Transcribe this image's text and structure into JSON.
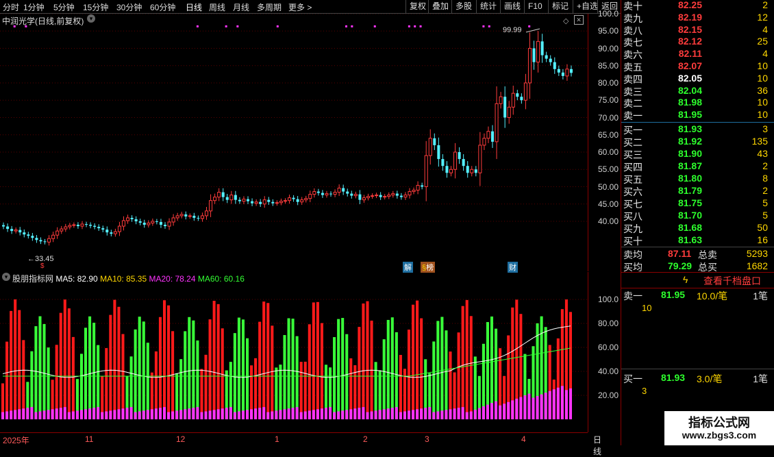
{
  "toolbar": {
    "periods": [
      "分时",
      "1分钟",
      "5分钟",
      "15分钟",
      "30分钟",
      "60分钟",
      "日线",
      "周线",
      "月线",
      "多周期",
      "更多 >"
    ],
    "right": [
      "复权",
      "叠加",
      "多股",
      "统计",
      "画线",
      "F10",
      "标记",
      "+自选",
      "返回"
    ]
  },
  "main_title": "中润光学(日线,前复权)",
  "y_labels_main": [
    "100.0",
    "95.00",
    "90.00",
    "85.00",
    "80.00",
    "75.00",
    "70.00",
    "65.00",
    "60.00",
    "55.00",
    "50.00",
    "45.00",
    "40.00"
  ],
  "annotations": {
    "high": "99.99",
    "low": "33.45",
    "chip_jie": "解",
    "chip_bang": "榜",
    "chip_cai": "财"
  },
  "ind_title": {
    "name": "股朋指标网",
    "ma5": "MA5: 82.90",
    "ma10": "MA10: 85.35",
    "ma20": "MA20: 78.24",
    "ma60": "MA60: 60.16"
  },
  "y_labels_ind": [
    "100.0",
    "80.00",
    "60.00",
    "40.00",
    "20.00"
  ],
  "dates": [
    "2025年",
    "11",
    "12",
    "1",
    "2",
    "3",
    "4"
  ],
  "period_label": "日线",
  "orderbook": {
    "sell": [
      {
        "n": "卖十",
        "p": "82.25",
        "v": "2"
      },
      {
        "n": "卖九",
        "p": "82.19",
        "v": "12"
      },
      {
        "n": "卖八",
        "p": "82.15",
        "v": "4"
      },
      {
        "n": "卖七",
        "p": "82.12",
        "v": "25"
      },
      {
        "n": "卖六",
        "p": "82.11",
        "v": "4"
      },
      {
        "n": "卖五",
        "p": "82.07",
        "v": "10"
      },
      {
        "n": "卖四",
        "p": "82.05",
        "v": "10"
      },
      {
        "n": "卖三",
        "p": "82.04",
        "v": "36"
      },
      {
        "n": "卖二",
        "p": "81.98",
        "v": "10"
      },
      {
        "n": "卖一",
        "p": "81.95",
        "v": "10"
      }
    ],
    "buy": [
      {
        "n": "买一",
        "p": "81.93",
        "v": "3"
      },
      {
        "n": "买二",
        "p": "81.92",
        "v": "135"
      },
      {
        "n": "买三",
        "p": "81.90",
        "v": "43"
      },
      {
        "n": "买四",
        "p": "81.87",
        "v": "2"
      },
      {
        "n": "买五",
        "p": "81.80",
        "v": "8"
      },
      {
        "n": "买六",
        "p": "81.79",
        "v": "2"
      },
      {
        "n": "买七",
        "p": "81.75",
        "v": "5"
      },
      {
        "n": "买八",
        "p": "81.70",
        "v": "5"
      },
      {
        "n": "买九",
        "p": "81.68",
        "v": "50"
      },
      {
        "n": "买十",
        "p": "81.63",
        "v": "16"
      }
    ],
    "avg_sell_label": "卖均",
    "avg_sell": "87.11",
    "total_sell_label": "总卖",
    "total_sell": "5293",
    "avg_buy_label": "买均",
    "avg_buy": "79.29",
    "total_buy_label": "总买",
    "total_buy": "1682",
    "thousand_btn": "查看千档盘口",
    "s1": {
      "label": "卖一",
      "price": "81.95",
      "qty": "10.0/笔",
      "cnt": "1笔",
      "detail": "10"
    },
    "b1": {
      "label": "买一",
      "price": "81.93",
      "qty": "3.0/笔",
      "cnt": "1笔",
      "detail": "3"
    }
  },
  "watermark": {
    "title": "指标公式网",
    "url": "www.zbgs3.com"
  },
  "chart_data": [
    {
      "type": "candlestick",
      "title": "中润光学(日线,前复权)",
      "ylim": [
        35,
        102
      ],
      "closes": [
        38.5,
        37.8,
        37.2,
        37.5,
        36.8,
        36.2,
        35.8,
        35.2,
        34.6,
        34.2,
        34.0,
        35.0,
        36.0,
        37.2,
        37.8,
        38.4,
        38.8,
        39.0,
        38.6,
        39.2,
        39.0,
        38.7,
        38.4,
        38.0,
        37.6,
        36.8,
        36.4,
        37.0,
        38.6,
        40.2,
        41.0,
        40.6,
        40.0,
        39.6,
        39.0,
        39.5,
        40.0,
        39.8,
        39.0,
        38.6,
        39.8,
        41.0,
        41.6,
        42.0,
        41.4,
        41.6,
        41.0,
        40.8,
        41.6,
        43.0,
        46.0,
        47.0,
        48.4,
        47.0,
        46.2,
        47.6,
        46.2,
        45.8,
        46.4,
        45.8,
        45.2,
        45.6,
        45.0,
        46.2,
        45.6,
        45.2,
        45.4,
        45.8,
        46.0,
        46.8,
        46.4,
        45.6,
        46.2,
        46.6,
        47.8,
        48.6,
        48.2,
        47.6,
        48.0,
        47.8,
        48.4,
        49.6,
        48.6,
        48.0,
        47.4,
        47.8,
        46.2,
        46.8,
        47.2,
        47.4,
        47.6,
        47.0,
        47.2,
        47.6,
        48.0,
        47.4,
        47.0,
        47.6,
        48.6,
        49.0,
        50.4,
        50.0,
        59.0,
        64.0,
        62.0,
        58.0,
        56.0,
        54.0,
        55.0,
        60.0,
        58.0,
        56.0,
        54.0,
        55.0,
        54.0,
        62.0,
        64.0,
        66.0,
        63.0,
        74.0,
        76.0,
        70.0,
        73.0,
        77.0,
        76.0,
        75.0,
        80.0,
        90.0,
        86.0,
        92.0,
        88.0,
        87.0,
        86.0,
        84.0,
        83.0,
        82.0,
        84.0,
        82.9
      ]
    },
    {
      "type": "bar",
      "title": "股朋指标网",
      "ylim": [
        0,
        110
      ],
      "series": [
        {
          "name": "MA5",
          "values": [
            82.9
          ]
        },
        {
          "name": "MA10",
          "values": [
            85.35
          ]
        },
        {
          "name": "MA20",
          "values": [
            78.24
          ]
        },
        {
          "name": "MA60",
          "values": [
            60.16
          ]
        }
      ]
    }
  ]
}
